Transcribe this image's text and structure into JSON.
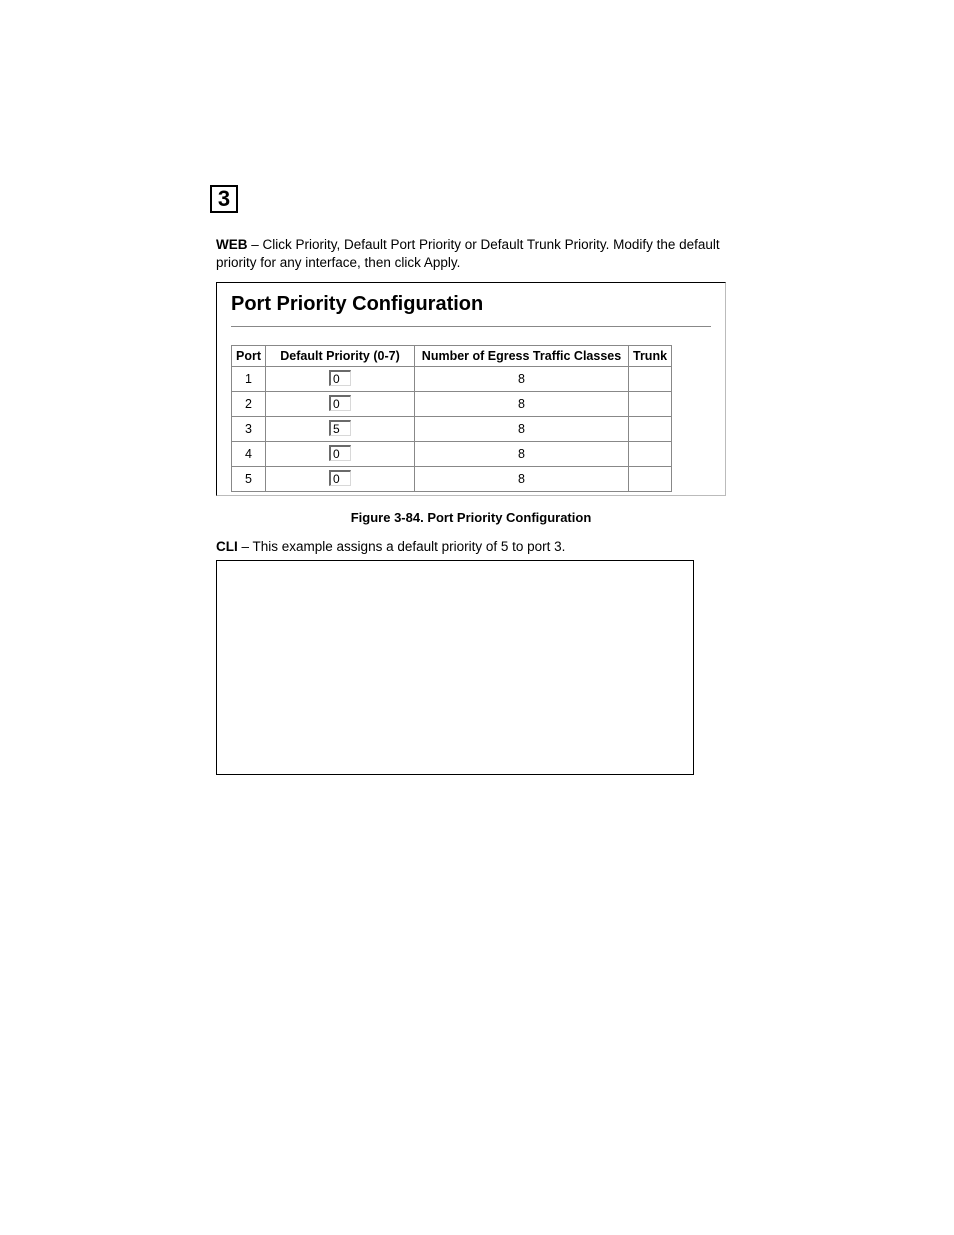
{
  "chapter": "3",
  "web_prefix": "WEB",
  "web_text": " – Click Priority, Default Port Priority or Default Trunk Priority. Modify the default priority for any interface, then click Apply.",
  "panel": {
    "title": "Port Priority Configuration",
    "headers": {
      "port": "Port",
      "priority": "Default Priority (0-7)",
      "egress": "Number of Egress Traffic Classes",
      "trunk": "Trunk"
    },
    "rows": [
      {
        "port": "1",
        "priority": "0",
        "egress": "8",
        "trunk": ""
      },
      {
        "port": "2",
        "priority": "0",
        "egress": "8",
        "trunk": ""
      },
      {
        "port": "3",
        "priority": "5",
        "egress": "8",
        "trunk": ""
      },
      {
        "port": "4",
        "priority": "0",
        "egress": "8",
        "trunk": ""
      },
      {
        "port": "5",
        "priority": "0",
        "egress": "8",
        "trunk": ""
      }
    ]
  },
  "figure_caption": "Figure 3-84.  Port Priority Configuration",
  "cli_prefix": "CLI",
  "cli_text": " – This example assigns a default priority of 5 to port 3."
}
